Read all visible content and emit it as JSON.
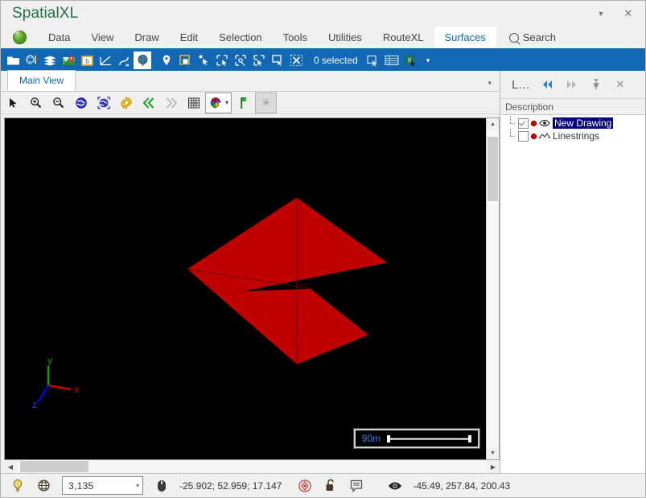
{
  "window": {
    "title": "SpatialXL",
    "accent_color": "#1268b3",
    "title_color": "#217346",
    "buttons": [
      {
        "name": "titlebar-dropdown",
        "glyph": "▼"
      },
      {
        "name": "titlebar-close",
        "glyph": "✕"
      }
    ]
  },
  "ribbon": {
    "logo_name": "app-globe-logo",
    "tabs": [
      {
        "label": "Data",
        "active": false
      },
      {
        "label": "View",
        "active": false
      },
      {
        "label": "Draw",
        "active": false
      },
      {
        "label": "Edit",
        "active": false
      },
      {
        "label": "Selection",
        "active": false
      },
      {
        "label": "Tools",
        "active": false
      },
      {
        "label": "Utilities",
        "active": false
      },
      {
        "label": "RouteXL",
        "active": false
      },
      {
        "label": "Surfaces",
        "active": true
      }
    ],
    "search_label": "Search"
  },
  "toolbar": {
    "icons": [
      {
        "name": "open-folder-icon"
      },
      {
        "name": "palette-brush-icon"
      },
      {
        "name": "layers-stack-icon"
      },
      {
        "name": "map-pin-icon"
      },
      {
        "name": "boundary-icon"
      },
      {
        "name": "measure-angle-icon"
      },
      {
        "name": "curve-tool-icon"
      },
      {
        "name": "globe-icon",
        "selected": true
      },
      {
        "name": "location-pin-icon"
      },
      {
        "name": "window-select-icon"
      },
      {
        "name": "point-select-icon"
      },
      {
        "name": "add-node-icon"
      },
      {
        "name": "move-node-icon"
      },
      {
        "name": "delete-node-icon"
      },
      {
        "name": "box-node-icon"
      },
      {
        "name": "clear-selection-icon"
      }
    ],
    "selection_status": "0 selected",
    "right_icons": [
      {
        "name": "select-window-icon"
      },
      {
        "name": "table-view-icon"
      },
      {
        "name": "excel-export-icon"
      }
    ],
    "overflow_glyph": "▾"
  },
  "doc_tabs": {
    "tabs": [
      {
        "label": "Main View",
        "active": true
      }
    ],
    "overflow_glyph": "▾"
  },
  "viewbar": {
    "icons": [
      {
        "name": "pointer-tool-icon"
      },
      {
        "name": "zoom-in-icon"
      },
      {
        "name": "zoom-out-icon"
      },
      {
        "name": "globe-view-icon"
      },
      {
        "name": "globe-fit-icon"
      },
      {
        "name": "settings-gear-icon"
      },
      {
        "name": "previous-view-icon"
      },
      {
        "name": "next-view-icon"
      },
      {
        "name": "grid-toggle-icon"
      },
      {
        "name": "color-palette-dropdown"
      },
      {
        "name": "flag-marker-icon"
      },
      {
        "name": "asterisk-button"
      }
    ],
    "asterisk_glyph": "✳"
  },
  "viewport": {
    "background": "#000000",
    "surface_color": "#c00000",
    "scale_bar": {
      "label": "90m"
    },
    "axes": [
      {
        "name": "x-axis",
        "label": "x",
        "color": "#d40000"
      },
      {
        "name": "y-axis",
        "label": "y",
        "color": "#00a000"
      },
      {
        "name": "z-axis",
        "label": "z",
        "color": "#0000e0"
      }
    ],
    "scrollbars": {
      "v_up_glyph": "▲",
      "v_down_glyph": "▼",
      "h_left_glyph": "◀",
      "h_right_glyph": "▶"
    }
  },
  "right_panel": {
    "title": "L...",
    "buttons": [
      {
        "name": "panel-back-button",
        "glyph": "◀◀"
      },
      {
        "name": "panel-forward-button",
        "glyph": "▶▶"
      },
      {
        "name": "panel-pin-button",
        "glyph": "⚲"
      },
      {
        "name": "panel-close-button",
        "glyph": "✕"
      }
    ],
    "column_header": "Description",
    "tree": [
      {
        "label": "New Drawing",
        "checked": true,
        "selected": true,
        "icon": "eye-visible-icon",
        "dot_color": "#cc0000"
      },
      {
        "label": "Linestrings",
        "checked": false,
        "selected": false,
        "icon": "linestring-icon",
        "dot_color": "#cc0000"
      }
    ]
  },
  "statusbar": {
    "icons": [
      {
        "name": "lightbulb-icon"
      },
      {
        "name": "globe-wireframe-icon"
      }
    ],
    "scale_value": "3,135",
    "scale_caret": "▾",
    "mouse_icon": "mouse-icon",
    "mouse_coords": "-25.902; 52.959; 17.147",
    "mid_icons": [
      {
        "name": "snap-target-icon"
      },
      {
        "name": "unlock-icon"
      },
      {
        "name": "annotation-icon"
      }
    ],
    "eye_icon": "eye-icon",
    "camera_coords": "-45.49, 257.84, 200.43"
  }
}
